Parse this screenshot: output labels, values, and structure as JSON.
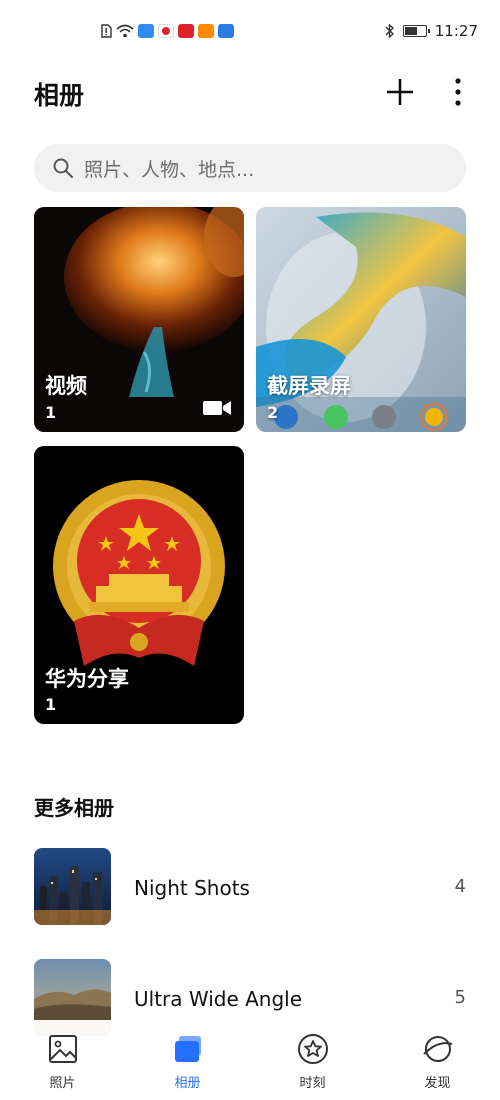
{
  "status_bar": {
    "time": "11:27",
    "battery_level": 0.65,
    "icons": [
      "sim-alert-icon",
      "wifi-icon",
      "cloud-app-icon",
      "huawei-app-icon",
      "huawei-store-icon",
      "video-app-icon",
      "tablet-app-icon",
      "bluetooth-icon",
      "battery-icon"
    ]
  },
  "header": {
    "title": "相册",
    "add_icon": "plus-icon",
    "more_icon": "more-vertical-icon"
  },
  "search": {
    "placeholder": "照片、人物、地点..."
  },
  "albums": [
    {
      "name": "视频",
      "count": "1",
      "badge_icon": "video-camera-icon"
    },
    {
      "name": "截屏录屏",
      "count": "2"
    },
    {
      "name": "华为分享",
      "count": "1"
    }
  ],
  "more_albums": {
    "title": "更多相册",
    "items": [
      {
        "name": "Night Shots",
        "count": "4"
      },
      {
        "name": "Ultra Wide Angle",
        "count": "5"
      }
    ]
  },
  "bottom_nav": {
    "items": [
      {
        "label": "照片",
        "icon": "photo-icon",
        "active": false
      },
      {
        "label": "相册",
        "icon": "albums-icon",
        "active": true
      },
      {
        "label": "时刻",
        "icon": "star-icon",
        "active": false
      },
      {
        "label": "发现",
        "icon": "discover-planet-icon",
        "active": false
      }
    ]
  },
  "colors": {
    "accent": "#256fff",
    "search_bg": "#f0f1f0"
  }
}
